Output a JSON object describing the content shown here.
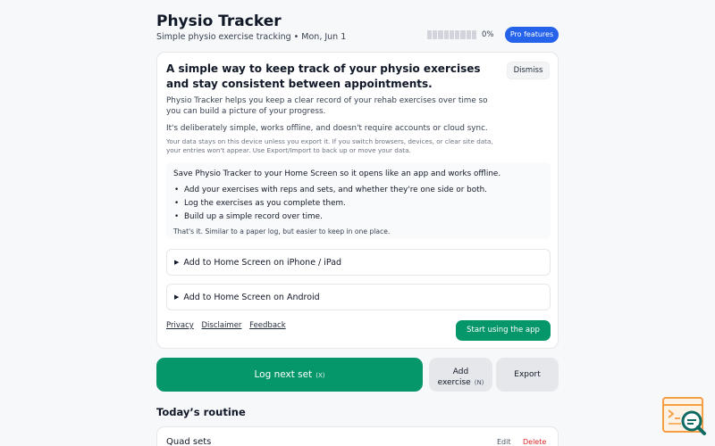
{
  "header": {
    "title": "Physio Tracker",
    "subtitle": "Simple physio exercise tracking • Mon, Jun 1",
    "progress_percent": 0,
    "progress_label": "0%",
    "pro_label": "Pro features"
  },
  "intro": {
    "heading": "A simple way to keep track of your physio exercises and stay consistent between appointments.",
    "dismiss_label": "Dismiss",
    "para1": "Physio Tracker helps you keep a clear record of your rehab exercises over time so you can build a picture of your progress.",
    "para2": "It's deliberately simple, works offline, and doesn't require accounts or cloud sync.",
    "privacy_note": "Your data stays on this device unless you export it. If you switch browsers, devices, or clear site data, your entries won't appear. Use Export/Import to back up or move your data.",
    "tips": {
      "heading": "Save Physio Tracker to your Home Screen so it opens like an app and works offline.",
      "items": [
        "Add your exercises with reps and sets, and whether they're one side or both.",
        "Log the exercises as you complete them.",
        "Build up a simple record over time."
      ],
      "footer": "That's it. Similar to a paper log, but easier to keep in one place."
    },
    "disclosure_ios": "Add to Home Screen on iPhone / iPad",
    "disclosure_android": "Add to Home Screen on Android",
    "links": {
      "privacy": "Privacy",
      "disclaimer": "Disclaimer",
      "feedback": "Feedback"
    },
    "start_label": "Start using the app"
  },
  "actions": {
    "log_label": "Log next set",
    "log_shortcut": "(X)",
    "add_line1": "Add",
    "add_line2": "exercise",
    "add_shortcut": "(N)",
    "export_label": "Export"
  },
  "routine": {
    "title": "Today’s routine",
    "items": [
      {
        "name": "Quad sets",
        "edit": "Edit",
        "delete": "Delete"
      }
    ]
  },
  "colors": {
    "primary_green": "#059669",
    "pro_blue": "#2563eb",
    "delete_red": "#dc2626",
    "fab_orange": "#f59e42",
    "fab_teal": "#0f6b63"
  },
  "icons": {
    "triangle": "▶"
  }
}
